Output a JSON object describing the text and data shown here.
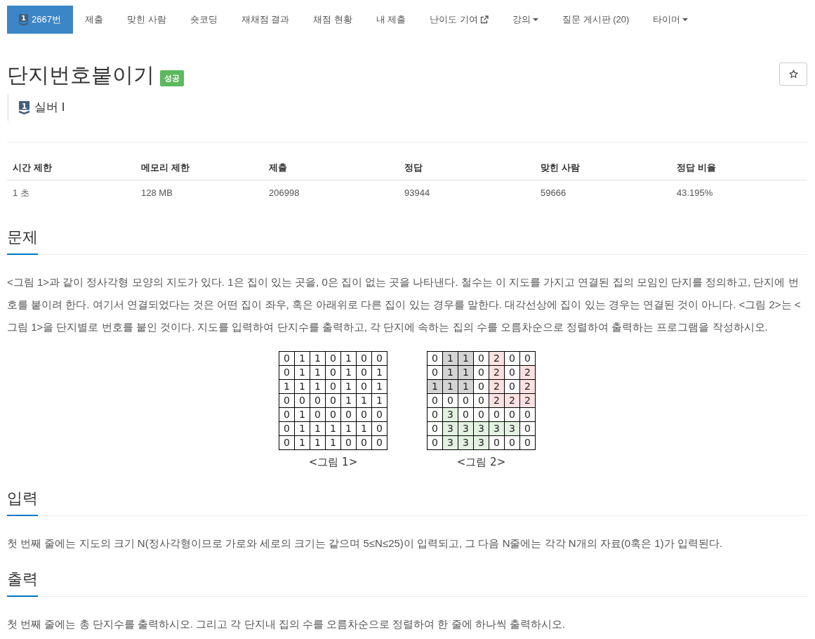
{
  "nav": {
    "items": [
      {
        "label": "2667번",
        "kind": "problem",
        "badge": "1",
        "selected": true
      },
      {
        "label": "제출",
        "kind": "link",
        "selected": false
      },
      {
        "label": "맞힌 사람",
        "kind": "link",
        "selected": false
      },
      {
        "label": "숏코딩",
        "kind": "link",
        "selected": false
      },
      {
        "label": "재채점 결과",
        "kind": "link",
        "selected": false
      },
      {
        "label": "채점 현황",
        "kind": "link",
        "selected": false
      },
      {
        "label": "내 제출",
        "kind": "link",
        "selected": false
      },
      {
        "label": "난이도 기여",
        "kind": "external",
        "selected": false
      },
      {
        "label": "강의",
        "kind": "dropdown",
        "selected": false
      },
      {
        "label": "질문 게시판 (20)",
        "kind": "link",
        "selected": false
      },
      {
        "label": "타이머",
        "kind": "dropdown",
        "selected": false
      }
    ]
  },
  "problem": {
    "title": "단지번호붙이기",
    "status_badge": "성공",
    "favorite_button": {
      "starred": false
    },
    "tier": {
      "badge": "1",
      "label": "실버 I"
    }
  },
  "stats_table": {
    "columns": [
      "시간 제한",
      "메모리 제한",
      "제출",
      "정답",
      "맞힌 사람",
      "정답 비율"
    ],
    "rows": [
      [
        "1 초",
        "128 MB",
        "206998",
        "93944",
        "59666",
        "43.195%"
      ]
    ]
  },
  "sections": [
    {
      "heading": "문제",
      "paragraphs": [
        "<그림 1>과 같이 정사각형 모양의 지도가 있다. 1은 집이 있는 곳을, 0은 집이 없는 곳을 나타낸다. 철수는 이 지도를 가지고 연결된 집의 모임인 단지를 정의하고, 단지에 번호를 붙이려 한다. 여기서 연결되었다는 것은 어떤 집이 좌우, 혹은 아래위로 다른 집이 있는 경우를 말한다. 대각선상에 집이 있는 경우는 연결된 것이 아니다. <그림 2>는 <그림 1>을 단지별로 번호를 붙인 것이다. 지도를 입력하여 단지수를 출력하고, 각 단지에 속하는 집의 수를 오름차순으로 정렬하여 출력하는 프로그램을 작성하시오."
      ],
      "figures": [
        {
          "caption": "<그림 1>",
          "rows": [
            [
              "0",
              "1",
              "1",
              "0",
              "1",
              "0",
              "0"
            ],
            [
              "0",
              "1",
              "1",
              "0",
              "1",
              "0",
              "1"
            ],
            [
              "1",
              "1",
              "1",
              "0",
              "1",
              "0",
              "1"
            ],
            [
              "0",
              "0",
              "0",
              "0",
              "1",
              "1",
              "1"
            ],
            [
              "0",
              "1",
              "0",
              "0",
              "0",
              "0",
              "0"
            ],
            [
              "0",
              "1",
              "1",
              "1",
              "1",
              "1",
              "0"
            ],
            [
              "0",
              "1",
              "1",
              "1",
              "0",
              "0",
              "0"
            ]
          ]
        },
        {
          "caption": "<그림 2>",
          "rows": [
            [
              {
                "text": "0",
                "color": "#ffffff"
              },
              {
                "text": "1",
                "color": "#d4d4d4"
              },
              {
                "text": "1",
                "color": "#d4d4d4"
              },
              {
                "text": "0",
                "color": "#ffffff"
              },
              {
                "text": "2",
                "color": "#fde1e1"
              },
              {
                "text": "0",
                "color": "#ffffff"
              },
              {
                "text": "0",
                "color": "#ffffff"
              }
            ],
            [
              {
                "text": "0",
                "color": "#ffffff"
              },
              {
                "text": "1",
                "color": "#d4d4d4"
              },
              {
                "text": "1",
                "color": "#d4d4d4"
              },
              {
                "text": "0",
                "color": "#ffffff"
              },
              {
                "text": "2",
                "color": "#fde1e1"
              },
              {
                "text": "0",
                "color": "#ffffff"
              },
              {
                "text": "2",
                "color": "#fde1e1"
              }
            ],
            [
              {
                "text": "1",
                "color": "#d4d4d4"
              },
              {
                "text": "1",
                "color": "#d4d4d4"
              },
              {
                "text": "1",
                "color": "#d4d4d4"
              },
              {
                "text": "0",
                "color": "#ffffff"
              },
              {
                "text": "2",
                "color": "#fde1e1"
              },
              {
                "text": "0",
                "color": "#ffffff"
              },
              {
                "text": "2",
                "color": "#fde1e1"
              }
            ],
            [
              {
                "text": "0",
                "color": "#ffffff"
              },
              {
                "text": "0",
                "color": "#ffffff"
              },
              {
                "text": "0",
                "color": "#ffffff"
              },
              {
                "text": "0",
                "color": "#ffffff"
              },
              {
                "text": "2",
                "color": "#fde1e1"
              },
              {
                "text": "2",
                "color": "#fde1e1"
              },
              {
                "text": "2",
                "color": "#fde1e1"
              }
            ],
            [
              {
                "text": "0",
                "color": "#ffffff"
              },
              {
                "text": "3",
                "color": "#e3f2e1"
              },
              {
                "text": "0",
                "color": "#ffffff"
              },
              {
                "text": "0",
                "color": "#ffffff"
              },
              {
                "text": "0",
                "color": "#ffffff"
              },
              {
                "text": "0",
                "color": "#ffffff"
              },
              {
                "text": "0",
                "color": "#ffffff"
              }
            ],
            [
              {
                "text": "0",
                "color": "#ffffff"
              },
              {
                "text": "3",
                "color": "#e3f2e1"
              },
              {
                "text": "3",
                "color": "#e3f2e1"
              },
              {
                "text": "3",
                "color": "#e3f2e1"
              },
              {
                "text": "3",
                "color": "#e3f2e1"
              },
              {
                "text": "3",
                "color": "#e3f2e1"
              },
              {
                "text": "0",
                "color": "#ffffff"
              }
            ],
            [
              {
                "text": "0",
                "color": "#ffffff"
              },
              {
                "text": "3",
                "color": "#e3f2e1"
              },
              {
                "text": "3",
                "color": "#e3f2e1"
              },
              {
                "text": "3",
                "color": "#e3f2e1"
              },
              {
                "text": "0",
                "color": "#ffffff"
              },
              {
                "text": "0",
                "color": "#ffffff"
              },
              {
                "text": "0",
                "color": "#ffffff"
              }
            ]
          ]
        }
      ]
    },
    {
      "heading": "입력",
      "paragraphs": [
        "첫 번째 줄에는 지도의 크기 N(정사각형이므로 가로와 세로의 크기는 같으며 5≤N≤25)이 입력되고, 그 다음 N줄에는 각각 N개의 자료(0혹은 1)가 입력된다."
      ]
    },
    {
      "heading": "출력",
      "paragraphs": [
        "첫 번째 줄에는 총 단지수를 출력하시오. 그리고 각 단지내 집의 수를 오름차순으로 정렬하여 한 줄에 하나씩 출력하시오."
      ]
    }
  ]
}
